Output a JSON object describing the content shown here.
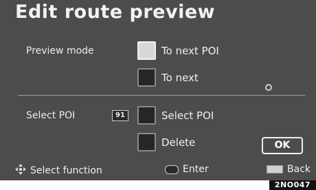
{
  "title": "Edit route preview",
  "preview_mode": {
    "label": "Preview mode",
    "options": [
      {
        "label": "To next POI",
        "selected": true
      },
      {
        "label": "To next",
        "selected": false
      }
    ]
  },
  "select_poi": {
    "label": "Select POI",
    "badge": "91",
    "options": [
      {
        "label": "Select POI"
      },
      {
        "label": "Delete"
      }
    ]
  },
  "ok_label": "OK",
  "footer": {
    "select_function": "Select function",
    "enter": "Enter",
    "back": "Back"
  },
  "figure_code": "2NO047",
  "icons": {
    "footer_left": "joystick-icon",
    "footer_middle": "enter-button-icon",
    "footer_right": "back-button-icon",
    "indicator": "circle-indicator-icon"
  }
}
